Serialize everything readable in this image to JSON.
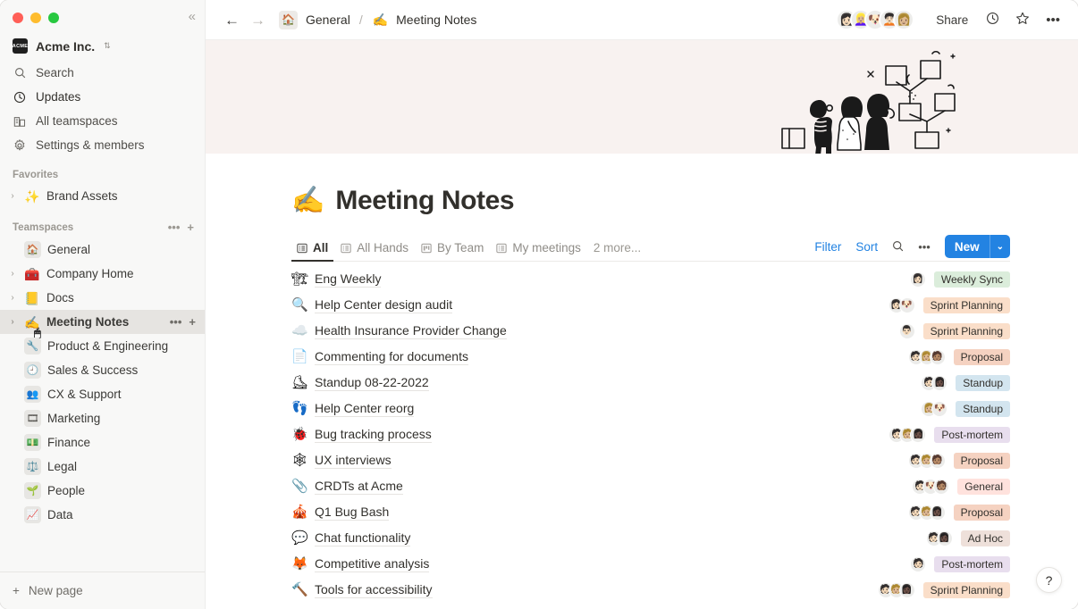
{
  "window": {
    "traffic_lights": [
      "close",
      "minimize",
      "maximize"
    ],
    "collapse_label": "«"
  },
  "sidebar": {
    "workspace": {
      "logo_text": "ACME",
      "name": "Acme Inc.",
      "chevron": "⌃⌄"
    },
    "nav": [
      {
        "icon": "search-icon",
        "glyph": "⌕",
        "label": "Search"
      },
      {
        "icon": "clock-icon",
        "glyph": "◷",
        "label": "Updates"
      },
      {
        "icon": "teamspaces-icon",
        "glyph": "▥",
        "label": "All teamspaces"
      },
      {
        "icon": "gear-icon",
        "glyph": "⚙",
        "label": "Settings & members"
      }
    ],
    "favorites": {
      "label": "Favorites",
      "items": [
        {
          "emoji": "✨",
          "label": "Brand Assets"
        }
      ]
    },
    "teamspaces": {
      "label": "Teamspaces",
      "more_glyph": "•••",
      "add_glyph": "+",
      "items": [
        {
          "emoji": "🏠",
          "label": "General",
          "boxed": true,
          "expandable": false,
          "selected": false
        },
        {
          "emoji": "🧰",
          "label": "Company Home",
          "boxed": false,
          "expandable": true,
          "selected": false
        },
        {
          "emoji": "📒",
          "label": "Docs",
          "boxed": false,
          "expandable": true,
          "selected": false
        },
        {
          "emoji": "✍️",
          "label": "Meeting Notes",
          "boxed": false,
          "expandable": true,
          "selected": true
        },
        {
          "emoji": "🔧",
          "label": "Product & Engineering",
          "boxed": true,
          "expandable": false,
          "selected": false
        },
        {
          "emoji": "🕘",
          "label": "Sales & Success",
          "boxed": true,
          "expandable": false,
          "selected": false
        },
        {
          "emoji": "👥",
          "label": "CX & Support",
          "boxed": true,
          "expandable": false,
          "selected": false
        },
        {
          "emoji": "🎞",
          "label": "Marketing",
          "boxed": true,
          "expandable": false,
          "selected": false
        },
        {
          "emoji": "💵",
          "label": "Finance",
          "boxed": true,
          "expandable": false,
          "selected": false
        },
        {
          "emoji": "⚖️",
          "label": "Legal",
          "boxed": true,
          "expandable": false,
          "selected": false
        },
        {
          "emoji": "🌱",
          "label": "People",
          "boxed": true,
          "expandable": false,
          "selected": false
        },
        {
          "emoji": "📈",
          "label": "Data",
          "boxed": true,
          "expandable": false,
          "selected": false
        }
      ]
    },
    "footer": {
      "glyph": "+",
      "label": "New page"
    }
  },
  "topbar": {
    "back_glyph": "←",
    "forward_glyph": "→",
    "breadcrumb": [
      {
        "type": "home",
        "emoji": "🏠",
        "label": "General"
      },
      {
        "type": "page",
        "emoji": "✍️",
        "label": "Meeting Notes"
      }
    ],
    "separator": "/",
    "collaborators": [
      "👩🏻",
      "👱🏼‍♀️",
      "🐶",
      "🧑🏻‍🦱",
      "👩🏼"
    ],
    "share_label": "Share",
    "history_glyph": "◷",
    "favorite_glyph": "☆",
    "more_glyph": "•••"
  },
  "cover": {
    "background_color": "#f8f2f0",
    "illustration": "people-looking-at-diagram"
  },
  "page": {
    "emoji": "✍️",
    "title": "Meeting Notes"
  },
  "views": {
    "tabs": [
      {
        "icon": "list-view-icon",
        "label": "All",
        "active": true
      },
      {
        "icon": "list-view-icon",
        "label": "All Hands",
        "active": false
      },
      {
        "icon": "board-view-icon",
        "label": "By Team",
        "active": false
      },
      {
        "icon": "list-view-icon",
        "label": "My meetings",
        "active": false
      }
    ],
    "more_label": "2 more...",
    "filter_label": "Filter",
    "sort_label": "Sort",
    "search_glyph": "⌕",
    "more_glyph": "•••",
    "new_label": "New",
    "new_chevron": "⌄",
    "accent_color": "#2383e2"
  },
  "tag_colors": {
    "Weekly Sync": "#dbeddb",
    "Sprint Planning": "#fadec9",
    "Proposal": "#f5d2c1",
    "Standup": "#d3e5ef",
    "Post-mortem": "#e8deee",
    "General": "#ffe2dd",
    "Ad Hoc": "#eee0da"
  },
  "rows": [
    {
      "emoji": "🏗",
      "title": "Eng Weekly",
      "people": [
        "👩🏻"
      ],
      "tag": "Weekly Sync"
    },
    {
      "emoji": "🔍",
      "title": "Help Center design audit",
      "people": [
        "👩🏻",
        "🐶"
      ],
      "tag": "Sprint Planning"
    },
    {
      "emoji": "☁️",
      "title": "Health Insurance Provider Change",
      "people": [
        "👨🏻"
      ],
      "tag": "Sprint Planning"
    },
    {
      "emoji": "📄",
      "title": "Commenting for documents",
      "people": [
        "🧑🏻",
        "👩🏼",
        "🧑🏽"
      ],
      "tag": "Proposal"
    },
    {
      "emoji": "⛸",
      "title": "Standup 08-22-2022",
      "people": [
        "🧑🏻",
        "👩🏿"
      ],
      "tag": "Standup"
    },
    {
      "emoji": "👣",
      "title": "Help Center reorg",
      "people": [
        "👩🏼",
        "🐶"
      ],
      "tag": "Standup"
    },
    {
      "emoji": "🐞",
      "title": "Bug tracking process",
      "people": [
        "🧑🏻",
        "🧑🏼",
        "👩🏿"
      ],
      "tag": "Post-mortem"
    },
    {
      "emoji": "🕸",
      "title": "UX interviews",
      "people": [
        "🧑🏻",
        "🧑🏼",
        "🧑🏽"
      ],
      "tag": "Proposal"
    },
    {
      "emoji": "📎",
      "title": "CRDTs at Acme",
      "people": [
        "🧑🏻",
        "🐶",
        "🧑🏽"
      ],
      "tag": "General"
    },
    {
      "emoji": "🎪",
      "title": "Q1 Bug Bash",
      "people": [
        "🧑🏻",
        "🧑🏼",
        "👩🏿"
      ],
      "tag": "Proposal"
    },
    {
      "emoji": "💬",
      "title": "Chat functionality",
      "people": [
        "🧑🏻",
        "👩🏿"
      ],
      "tag": "Ad Hoc"
    },
    {
      "emoji": "🦊",
      "title": "Competitive analysis",
      "people": [
        "🧑🏻"
      ],
      "tag": "Post-mortem"
    },
    {
      "emoji": "🔨",
      "title": "Tools for accessibility",
      "people": [
        "🧑🏻",
        "🧑🏼",
        "👩🏿"
      ],
      "tag": "Sprint Planning"
    }
  ],
  "help": {
    "glyph": "?"
  }
}
